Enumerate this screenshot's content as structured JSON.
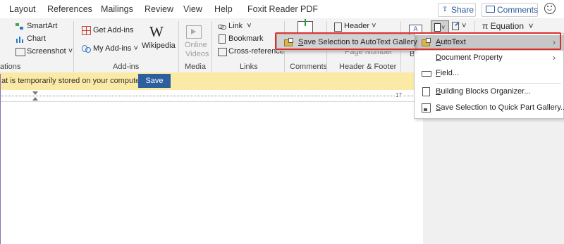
{
  "tabs": [
    "Layout",
    "References",
    "Mailings",
    "Review",
    "View",
    "Help",
    "Foxit Reader PDF"
  ],
  "top_buttons": {
    "share": "Share",
    "comments": "Comments"
  },
  "ribbon": {
    "illustrations": {
      "smartart": "SmartArt",
      "chart": "Chart",
      "screenshot": "Screenshot",
      "group": "ations"
    },
    "addins": {
      "get": "Get Add-ins",
      "my": "My Add-ins",
      "wikipedia": "Wikipedia",
      "group": "Add-ins"
    },
    "media": {
      "online_videos_1": "Online",
      "online_videos_2": "Videos",
      "group": "Media"
    },
    "links": {
      "link": "Link",
      "bookmark": "Bookmark",
      "cross_reference": "Cross-reference",
      "group": "Links"
    },
    "comments": {
      "group": "Comments"
    },
    "header_footer": {
      "header": "Header",
      "page_number": "Page Number",
      "group": "Header & Footer"
    },
    "text": {
      "equation": "Equation",
      "b_label": "B"
    }
  },
  "message_bar": {
    "text": "at is temporarily stored on your computer.",
    "save": "Save"
  },
  "ruler": {
    "mark": "17"
  },
  "quick_parts_menu": [
    {
      "label": "AutoText",
      "underline": "A",
      "rest": "utoText",
      "submenu": true,
      "icon": "autotext-icon"
    },
    {
      "label": "Document Property",
      "underline": "D",
      "rest": "ocument Property",
      "submenu": true,
      "icon": ""
    },
    {
      "label": "Field...",
      "underline": "F",
      "rest": "ield...",
      "submenu": false,
      "icon": "field-icon"
    },
    {
      "label": "Building Blocks Organizer...",
      "underline": "B",
      "rest": "uilding Blocks Organizer...",
      "submenu": false,
      "icon": "organizer-icon"
    },
    {
      "label": "Save Selection to Quick Part Gallery...",
      "underline": "S",
      "rest": "ave Selection to Quick Part Gallery...",
      "submenu": false,
      "icon": "save-gallery-icon"
    }
  ],
  "autotext_submenu": {
    "label": "Save Selection to AutoText Gallery",
    "underline": "S",
    "rest": "ave Selection to AutoText Gallery"
  },
  "colors": {
    "highlight_red": "#d9302c",
    "menu_hover": "#c7c7c7",
    "save_button": "#2b5f9e",
    "message_bar": "#fbe9a6"
  }
}
